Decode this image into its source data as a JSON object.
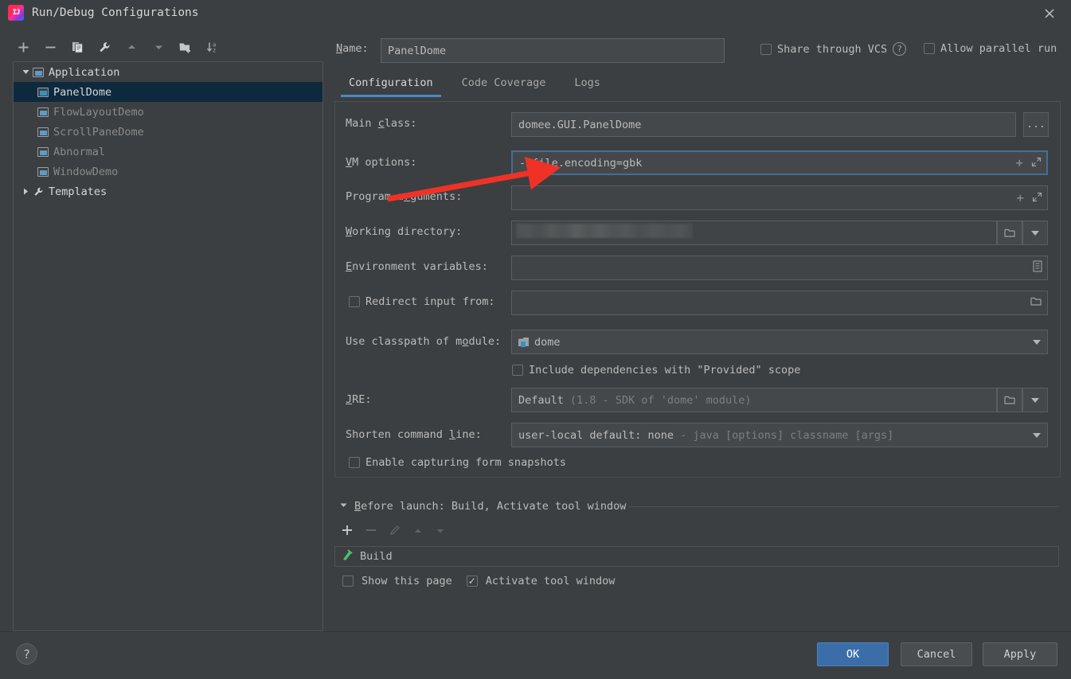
{
  "window": {
    "title": "Run/Debug Configurations",
    "logo_icon": "intellij-idea-logo",
    "close_icon": "close-icon"
  },
  "left_toolbar": {
    "buttons": [
      {
        "name": "add-configuration",
        "icon": "plus-icon",
        "glyph": "+"
      },
      {
        "name": "remove-configuration",
        "icon": "minus-icon",
        "glyph": "−"
      },
      {
        "name": "copy-configuration",
        "icon": "copy-icon",
        "glyph": "⧉"
      },
      {
        "name": "edit-templates",
        "icon": "wrench-icon",
        "glyph": "🔧"
      },
      {
        "name": "move-up",
        "icon": "arrow-up-icon",
        "glyph": "▲"
      },
      {
        "name": "move-down",
        "icon": "arrow-down-icon",
        "glyph": "▼"
      },
      {
        "name": "new-folder",
        "icon": "folder-add-icon",
        "glyph": "📁"
      },
      {
        "name": "sort-alphabetically",
        "icon": "sort-az-icon",
        "glyph": "↓az"
      }
    ]
  },
  "tree": {
    "items": [
      {
        "label": "Application",
        "level": 0,
        "expanded": true,
        "icon": "application-group-icon",
        "selected": false,
        "group": true
      },
      {
        "label": "PanelDome",
        "level": 1,
        "icon": "run-config-icon",
        "selected": true,
        "group": false
      },
      {
        "label": "FlowLayoutDemo",
        "level": 1,
        "icon": "run-config-icon",
        "selected": false,
        "group": false
      },
      {
        "label": "ScrollPaneDome",
        "level": 1,
        "icon": "run-config-icon",
        "selected": false,
        "group": false
      },
      {
        "label": "Abnormal",
        "level": 1,
        "icon": "run-config-icon",
        "selected": false,
        "group": false
      },
      {
        "label": "WindowDemo",
        "level": 1,
        "icon": "run-config-icon",
        "selected": false,
        "group": false
      },
      {
        "label": "Templates",
        "level": 0,
        "expanded": false,
        "icon": "wrench-icon",
        "selected": false,
        "group": true
      }
    ]
  },
  "name_field": {
    "label": "Name:",
    "value": "PanelDome",
    "placeholder": ""
  },
  "top_checkboxes": {
    "share_vcs": {
      "label": "Share through VCS",
      "checked": false
    },
    "help_icon": "help-icon",
    "allow_parallel": {
      "label": "Allow parallel run",
      "checked": false
    }
  },
  "tabs": [
    {
      "label": "Configuration",
      "active": true
    },
    {
      "label": "Code Coverage",
      "active": false
    },
    {
      "label": "Logs",
      "active": false
    }
  ],
  "fields": {
    "main_class": {
      "label": "Main class:",
      "value": "domee.GUI.PanelDome",
      "browse_label": "..."
    },
    "vm_options": {
      "label": "VM options:",
      "value": "-Dfile.encoding=gbk",
      "focused": true,
      "macro_icon": "plus-icon",
      "expand_icon": "expand-icon"
    },
    "program_arguments": {
      "label": "Program arguments:",
      "value": "",
      "macro_icon": "plus-icon",
      "expand_icon": "expand-icon"
    },
    "working_directory": {
      "label": "Working directory:",
      "value": "",
      "redacted": true,
      "browse_icon": "folder-icon",
      "dropdown_icon": "chevron-down-icon"
    },
    "environment_variables": {
      "label": "Environment variables:",
      "value": "",
      "browse_icon": "list-edit-icon"
    },
    "redirect_input": {
      "label": "Redirect input from:",
      "checked": false,
      "value": "",
      "browse_icon": "folder-icon"
    },
    "use_classpath": {
      "label": "Use classpath of module:",
      "value": "dome",
      "module_icon": "module-icon",
      "dropdown_icon": "chevron-down-icon"
    },
    "include_provided": {
      "label": "Include dependencies with \"Provided\" scope",
      "checked": false
    },
    "jre": {
      "label": "JRE:",
      "value": "Default",
      "value_hint": "(1.8 - SDK of 'dome' module)",
      "browse_icon": "folder-icon",
      "dropdown_icon": "chevron-down-icon"
    },
    "shorten_command_line": {
      "label": "Shorten command line:",
      "value": "user-local default: none",
      "value_hint": "- java [options] classname [args]",
      "dropdown_icon": "chevron-down-icon"
    },
    "enable_capturing": {
      "label": "Enable capturing form snapshots",
      "checked": false
    }
  },
  "before_launch": {
    "header": "Before launch: Build, Activate tool window",
    "collapse_icon": "triangle-down-icon",
    "toolbar": [
      {
        "name": "add-task",
        "icon": "plus-icon",
        "glyph": "+",
        "enabled": true
      },
      {
        "name": "remove-task",
        "icon": "minus-icon",
        "glyph": "−",
        "enabled": false
      },
      {
        "name": "edit-task",
        "icon": "pencil-icon",
        "glyph": "✎",
        "enabled": false
      },
      {
        "name": "move-task-up",
        "icon": "arrow-up-icon",
        "glyph": "▲",
        "enabled": false
      },
      {
        "name": "move-task-down",
        "icon": "arrow-down-icon",
        "glyph": "▼",
        "enabled": false
      }
    ],
    "tasks": [
      {
        "label": "Build",
        "icon": "build-hammer-icon"
      }
    ],
    "show_this_page": {
      "label": "Show this page",
      "checked": false
    },
    "activate_tool_window": {
      "label": "Activate tool window",
      "checked": true
    }
  },
  "footer": {
    "help_icon": "question-mark-icon",
    "ok": "OK",
    "cancel": "Cancel",
    "apply": "Apply"
  },
  "annotation": {
    "arrow_color": "#f03226",
    "description": "red-arrow-pointing-to-vm-options"
  },
  "colors": {
    "background": "#3c3f41",
    "field_background": "#45484a",
    "selection": "#0d293e",
    "accent": "#4a88c7",
    "primary_button": "#3b6ea8",
    "text": "#bbbbbb"
  }
}
